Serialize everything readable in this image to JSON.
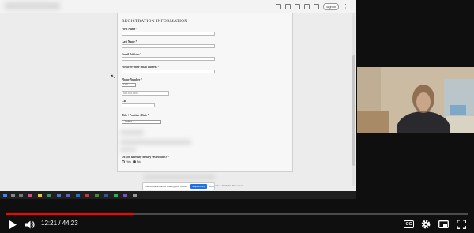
{
  "browser": {
    "signin_label": "Sign in",
    "menu_glyph": "⋮"
  },
  "form": {
    "title": "REGISTRATION INFORMATION",
    "first_name_label": "First Name *",
    "last_name_label": "Last Name *",
    "email_label": "Email Address *",
    "email_confirm_label": "Please re-enter email address *",
    "phone_label": "Phone Number *",
    "phone_type_value": "Cell",
    "phone_placeholder": "###-###-####",
    "cat_label": "Cat",
    "title_label": "Title / Position / Role *",
    "title_select_value": "- Select -",
    "dietary_label": "Do you have any dietary restrictions? *",
    "yes_label": "Yes",
    "no_label": "No"
  },
  "share_banner": {
    "text": "meet.google.com is sharing your screen.",
    "stop_label": "Stop sharing",
    "hide_label": "Hide"
  },
  "footer": {
    "text": "Center. All Rights Reserved."
  },
  "player": {
    "current_time": "12:21",
    "duration": "44:23",
    "time_display": "12:21 / 44:23",
    "progress_fraction": 0.278,
    "cc_label": "CC",
    "accent_color": "#ff0000"
  },
  "icons": {
    "play": "play-icon",
    "volume": "volume-icon",
    "captions": "captions-icon",
    "settings": "settings-icon",
    "miniplayer": "miniplayer-icon",
    "fullscreen": "fullscreen-icon"
  }
}
